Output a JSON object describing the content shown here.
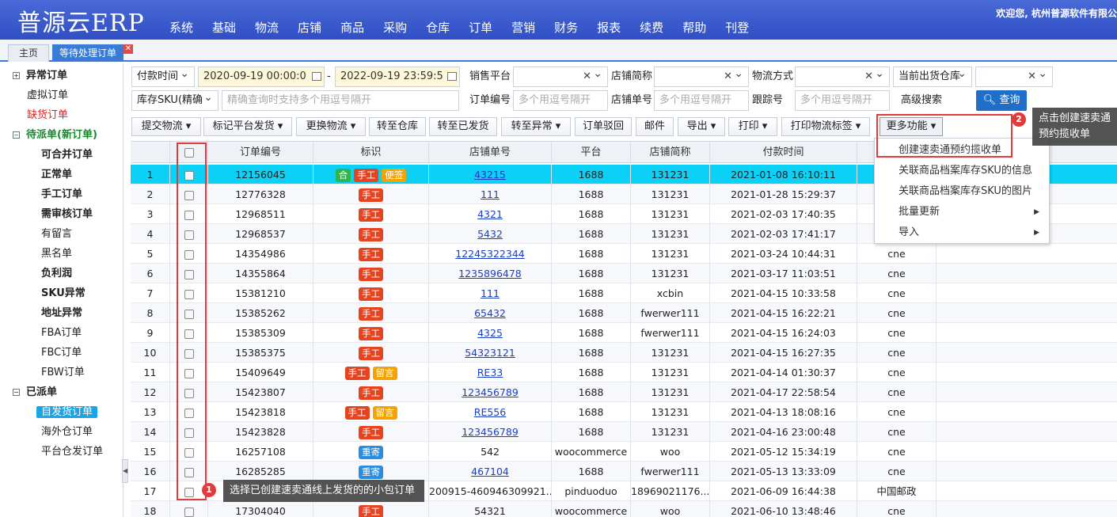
{
  "header": {
    "logo": "普源云ERP",
    "nav": [
      "系统",
      "基础",
      "物流",
      "店铺",
      "商品",
      "采购",
      "仓库",
      "订单",
      "营销",
      "财务",
      "报表",
      "续费",
      "帮助",
      "刊登"
    ],
    "welcome": "欢迎您, 杭州普源软件有限公"
  },
  "tabs": {
    "home": "主页",
    "active": "等待处理订单",
    "close": "✕"
  },
  "sidebar": {
    "g1": "异常订单",
    "i1": "虚拟订单",
    "i2": "缺货订单",
    "g2": "待派单(新订单)",
    "c1": "可合并订单",
    "c2": "正常单",
    "c3": "手工订单",
    "c4": "需审核订单",
    "c5": "有留言",
    "c6": "黑名单",
    "c7": "负利润",
    "c8": "SKU异常",
    "c9": "地址异常",
    "c10": "FBA订单",
    "c11": "FBC订单",
    "c12": "FBW订单",
    "g3": "已派单",
    "d1": "自发货订单",
    "d2": "海外仓订单",
    "d3": "平台仓发订单"
  },
  "filters": {
    "pay_time": "付款时间",
    "date_from": "2020-09-19 00:00:0",
    "dash": "-",
    "date_to": "2022-09-19 23:59:5",
    "platform_label": "销售平台",
    "shop_label": "店铺简称",
    "logistics_label": "物流方式",
    "warehouse_select": "当前出货仓库",
    "sku_select": "库存SKU(精确",
    "sku_placeholder": "精确查询时支持多个用逗号隔开",
    "order_no_label": "订单编号",
    "order_no_placeholder": "多个用逗号隔开",
    "shop_order_label": "店铺单号",
    "shop_order_placeholder": "多个用逗号隔开",
    "tracking_label": "跟踪号",
    "tracking_placeholder": "多个用逗号隔开",
    "advanced": "高级搜索",
    "query": "查询",
    "clear": "✕"
  },
  "toolbar": [
    "提交物流 ▾",
    "标记平台发货 ▾",
    "更换物流 ▾",
    "转至仓库",
    "转至已发货",
    "转至异常 ▾",
    "订单驳回",
    "邮件",
    "导出 ▾",
    "打印 ▾",
    "打印物流标签 ▾",
    "更多功能 ▾"
  ],
  "table": {
    "headers": [
      "订单编号",
      "标识",
      "店铺单号",
      "平台",
      "店铺简称",
      "付款时间",
      ""
    ],
    "rows": [
      {
        "n": "1",
        "id": "12156045",
        "tags": [
          "合",
          "手工",
          "便签"
        ],
        "shop_no": "43215",
        "link": true,
        "platform": "1688",
        "shop": "131231",
        "time": "2021-01-08 16:10:11",
        "extra": ""
      },
      {
        "n": "2",
        "id": "12776328",
        "tags": [
          "手工"
        ],
        "shop_no": "111",
        "link": true,
        "platform": "1688",
        "shop": "131231",
        "time": "2021-01-28 15:29:37",
        "extra": "am"
      },
      {
        "n": "3",
        "id": "12968511",
        "tags": [
          "手工"
        ],
        "shop_no": "4321",
        "link": true,
        "platform": "1688",
        "shop": "131231",
        "time": "2021-02-03 17:40:35",
        "extra": ""
      },
      {
        "n": "4",
        "id": "12968537",
        "tags": [
          "手工"
        ],
        "shop_no": "5432",
        "link": true,
        "platform": "1688",
        "shop": "131231",
        "time": "2021-02-03 17:41:17",
        "extra": ""
      },
      {
        "n": "5",
        "id": "14354986",
        "tags": [
          "手工"
        ],
        "shop_no": "12245322344",
        "link": true,
        "platform": "1688",
        "shop": "131231",
        "time": "2021-03-24 10:44:31",
        "extra": "cne"
      },
      {
        "n": "6",
        "id": "14355864",
        "tags": [
          "手工"
        ],
        "shop_no": "1235896478",
        "link": true,
        "platform": "1688",
        "shop": "131231",
        "time": "2021-03-17 11:03:51",
        "extra": "cne"
      },
      {
        "n": "7",
        "id": "15381210",
        "tags": [
          "手工"
        ],
        "shop_no": "111",
        "link": true,
        "platform": "1688",
        "shop": "xcbin",
        "time": "2021-04-15 10:33:58",
        "extra": "cne"
      },
      {
        "n": "8",
        "id": "15385262",
        "tags": [
          "手工"
        ],
        "shop_no": "65432",
        "link": true,
        "platform": "1688",
        "shop": "fwerwer111",
        "time": "2021-04-15 16:22:21",
        "extra": "cne"
      },
      {
        "n": "9",
        "id": "15385309",
        "tags": [
          "手工"
        ],
        "shop_no": "4325",
        "link": true,
        "platform": "1688",
        "shop": "fwerwer111",
        "time": "2021-04-15 16:24:03",
        "extra": "cne"
      },
      {
        "n": "10",
        "id": "15385375",
        "tags": [
          "手工"
        ],
        "shop_no": "54323121",
        "link": true,
        "platform": "1688",
        "shop": "131231",
        "time": "2021-04-15 16:27:35",
        "extra": "cne"
      },
      {
        "n": "11",
        "id": "15409649",
        "tags": [
          "手工",
          "留言"
        ],
        "shop_no": "RE33",
        "link": true,
        "platform": "1688",
        "shop": "131231",
        "time": "2021-04-14 01:30:37",
        "extra": "cne"
      },
      {
        "n": "12",
        "id": "15423807",
        "tags": [
          "手工"
        ],
        "shop_no": "123456789",
        "link": true,
        "platform": "1688",
        "shop": "131231",
        "time": "2021-04-17 22:58:54",
        "extra": "cne"
      },
      {
        "n": "13",
        "id": "15423818",
        "tags": [
          "手工",
          "留言"
        ],
        "shop_no": "RE556",
        "link": true,
        "platform": "1688",
        "shop": "131231",
        "time": "2021-04-13 18:08:16",
        "extra": "cne"
      },
      {
        "n": "14",
        "id": "15423828",
        "tags": [
          "手工"
        ],
        "shop_no": "123456789",
        "link": true,
        "platform": "1688",
        "shop": "131231",
        "time": "2021-04-16 23:00:48",
        "extra": "cne"
      },
      {
        "n": "15",
        "id": "16257108",
        "tags": [
          "重寄"
        ],
        "shop_no": "542",
        "link": false,
        "platform": "woocommerce",
        "shop": "woo",
        "time": "2021-05-12 15:34:19",
        "extra": "cne"
      },
      {
        "n": "16",
        "id": "16285285",
        "tags": [
          "重寄"
        ],
        "shop_no": "467104",
        "link": true,
        "platform": "1688",
        "shop": "fwerwer111",
        "time": "2021-05-13 13:33:09",
        "extra": "cne"
      },
      {
        "n": "17",
        "id": "",
        "tags": [],
        "shop_no": "200915-460946309921...",
        "link": false,
        "platform": "pinduoduo",
        "shop": "18969021176...",
        "time": "2021-06-09 16:44:38",
        "extra": "中国邮政"
      },
      {
        "n": "18",
        "id": "17304040",
        "tags": [
          "手工"
        ],
        "shop_no": "54321",
        "link": false,
        "platform": "woocommerce",
        "shop": "woo",
        "time": "2021-06-10 13:48:46",
        "extra": "cne"
      }
    ]
  },
  "dropdown": {
    "items": [
      "创建速卖通预约揽收单",
      "关联商品档案库存SKU的信息",
      "关联商品档案库存SKU的图片",
      "批量更新",
      "导入"
    ],
    "arrow": "▶"
  },
  "annotations": {
    "badge1": "1",
    "tip1": "选择已创建速卖通线上发货的的小包订单",
    "badge2": "2",
    "tip2_line1": "点击创建速卖通",
    "tip2_line2": "预约揽收单"
  }
}
